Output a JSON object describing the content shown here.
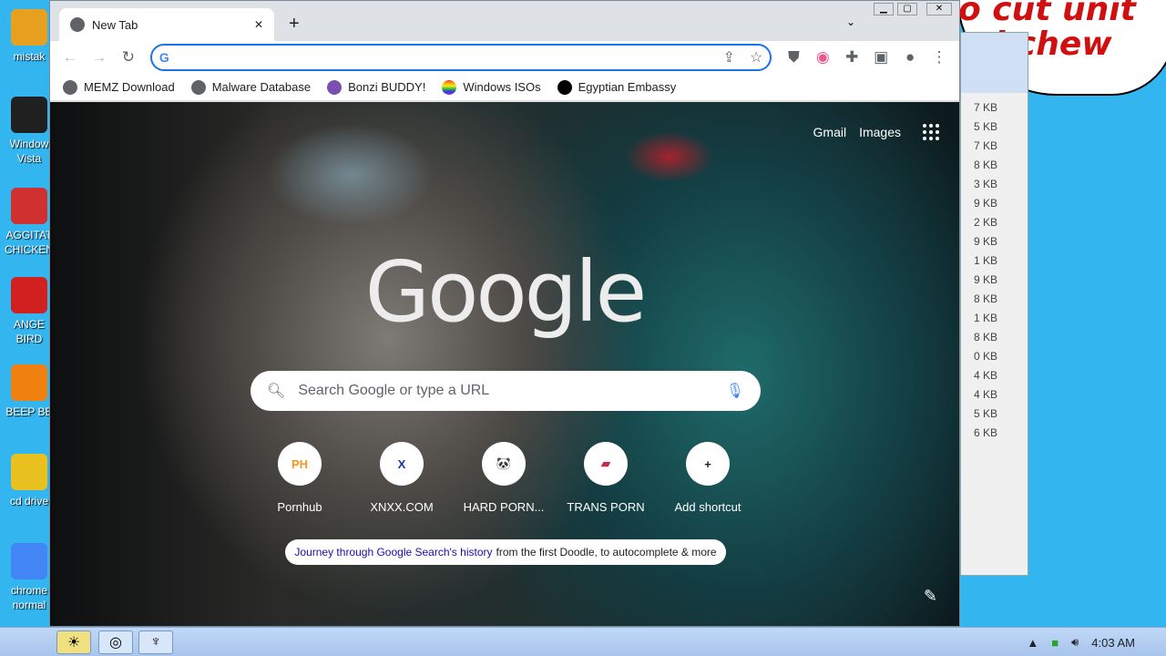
{
  "desktop": {
    "icons": [
      {
        "label": "mistak",
        "color": "#e8a020"
      },
      {
        "label": "Window Vista",
        "color": "#202020"
      },
      {
        "label": "AGGITAT CHICKEN",
        "color": "#d03030"
      },
      {
        "label": "ANGE BIRD",
        "color": "#d02020"
      },
      {
        "label": "BEEP BE",
        "color": "#f08010"
      },
      {
        "label": "cd drive",
        "color": "#e8c020"
      },
      {
        "label": "chrome normal",
        "color": "#4285f4"
      }
    ],
    "bubble_text": "o cut unit\nnd chew",
    "bg_window_sizes": [
      "7 KB",
      "5 KB",
      "7 KB",
      "8 KB",
      "3 KB",
      "9 KB",
      "2 KB",
      "9 KB",
      "1 KB",
      "9 KB",
      "8 KB",
      "1 KB",
      "8 KB",
      "0 KB",
      "4 KB",
      "4 KB",
      "5 KB",
      "6 KB"
    ]
  },
  "browser": {
    "tab": {
      "title": "New Tab",
      "close": "✕",
      "new_tab": "+"
    },
    "omnibox": {
      "value": "",
      "placeholder": ""
    },
    "bookmarks": [
      {
        "label": "MEMZ Download",
        "icon": "globe-icon"
      },
      {
        "label": "Malware Database",
        "icon": "globe-icon"
      },
      {
        "label": "Bonzi BUDDY!",
        "icon": "bonzi-icon"
      },
      {
        "label": "Windows ISOs",
        "icon": "rainbow-icon"
      },
      {
        "label": "Egyptian Embassy",
        "icon": "wix-icon"
      }
    ]
  },
  "ntp": {
    "gmail": "Gmail",
    "images": "Images",
    "logo": "Google",
    "search_placeholder": "Search Google or type a URL",
    "shortcuts": [
      {
        "label": "Pornhub",
        "glyph": "PH",
        "color": "#f7971d"
      },
      {
        "label": "XNXX.COM",
        "glyph": "X",
        "color": "#1034a6"
      },
      {
        "label": "HARD PORN...",
        "glyph": "🐼",
        "color": "#333333"
      },
      {
        "label": "TRANS PORN",
        "glyph": "▰",
        "color": "#c0304a"
      },
      {
        "label": "Add shortcut",
        "glyph": "+",
        "color": "#202124"
      }
    ],
    "journey_link": "Journey through Google Search's history",
    "journey_rest": "from the first Doodle, to autocomplete & more"
  },
  "taskbar": {
    "time": "4:03 AM"
  }
}
